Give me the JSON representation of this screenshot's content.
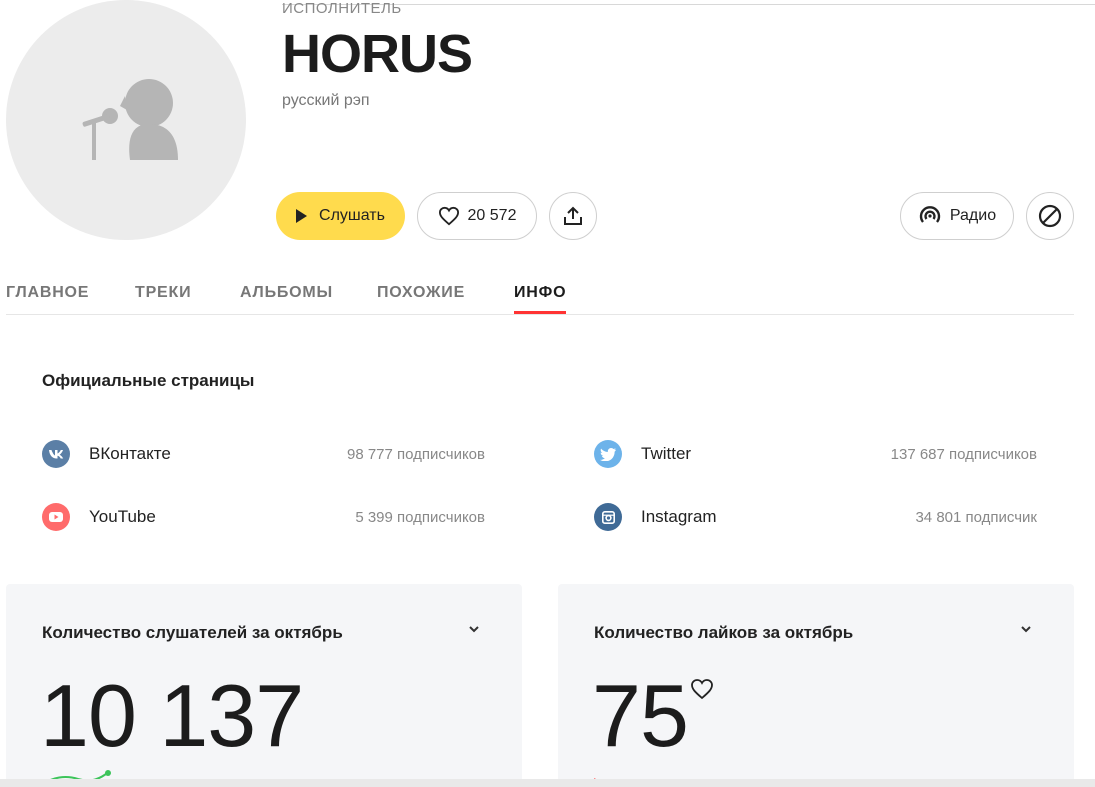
{
  "artist": {
    "kicker": "ИСПОЛНИТЕЛЬ",
    "name": "HORUS",
    "genre": "русский рэп"
  },
  "actions": {
    "listen_label": "Слушать",
    "likes_count": "20 572",
    "radio_label": "Радио"
  },
  "tabs": [
    {
      "label": "ГЛАВНОЕ",
      "active": false
    },
    {
      "label": "ТРЕКИ",
      "active": false
    },
    {
      "label": "АЛЬБОМЫ",
      "active": false
    },
    {
      "label": "ПОХОЖИЕ",
      "active": false
    },
    {
      "label": "ИНФО",
      "active": true
    }
  ],
  "official_pages": {
    "title": "Официальные страницы",
    "items": [
      {
        "name": "ВКонтакте",
        "count": "98 777 подписчиков",
        "icon": "vk-icon",
        "color": "#5b7fa6"
      },
      {
        "name": "YouTube",
        "count": "5 399 подписчиков",
        "icon": "youtube-icon",
        "color": "#ff6b6b"
      },
      {
        "name": "Twitter",
        "count": "137 687 подписчиков",
        "icon": "twitter-icon",
        "color": "#6db3ea"
      },
      {
        "name": "Instagram",
        "count": "34 801 подписчик",
        "icon": "instagram-icon",
        "color": "#3f6a96"
      }
    ]
  },
  "stats": [
    {
      "title": "Количество слушателей за октябрь",
      "value": "10 137"
    },
    {
      "title": "Количество лайков за октябрь",
      "value": "75"
    }
  ],
  "colors": {
    "accent_yellow": "#ffdb4d",
    "tab_underline": "#ff3333",
    "card_bg": "#f5f6f8"
  }
}
